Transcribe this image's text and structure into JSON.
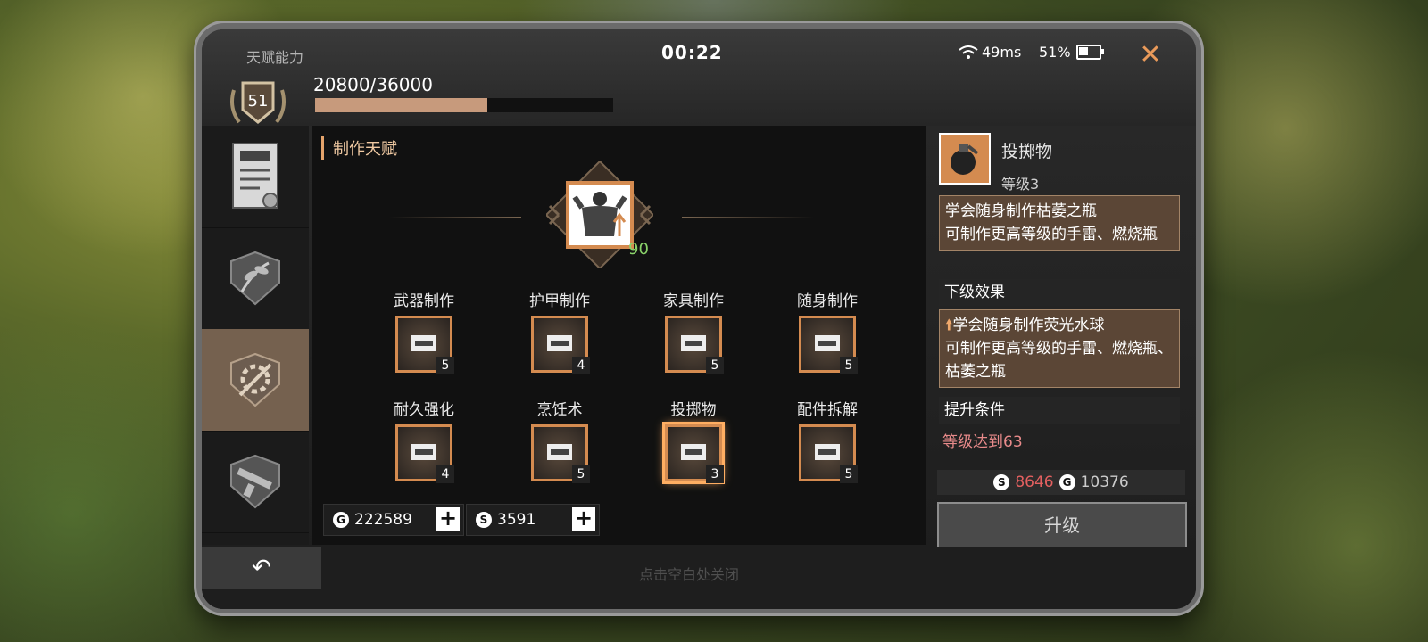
{
  "header": {
    "title": "天赋能力",
    "timer": "00:22",
    "ping": "49ms",
    "battery_percent": "51%",
    "battery_level": 0.51,
    "close_icon": "close-icon"
  },
  "player": {
    "level": "51",
    "xp_text": "20800/36000",
    "xp_fraction": 0.578
  },
  "sidebar": {
    "items": [
      {
        "icon": "trade-scroll-icon"
      },
      {
        "icon": "herb-icon"
      },
      {
        "icon": "crafting-gear-icon"
      },
      {
        "icon": "weapon-icon"
      }
    ],
    "active_index": 2
  },
  "main": {
    "section_title": "制作天赋",
    "center_points": "90",
    "skills": [
      {
        "name": "武器制作",
        "level": "5",
        "icon": "pistol-icon"
      },
      {
        "name": "护甲制作",
        "level": "4",
        "icon": "armor-icon"
      },
      {
        "name": "家具制作",
        "level": "5",
        "icon": "furniture-icon"
      },
      {
        "name": "随身制作",
        "level": "5",
        "icon": "case-icon"
      },
      {
        "name": "耐久强化",
        "level": "4",
        "icon": "calculator-icon"
      },
      {
        "name": "烹饪术",
        "level": "5",
        "icon": "stove-icon"
      },
      {
        "name": "投掷物",
        "level": "3",
        "icon": "grenade-icon"
      },
      {
        "name": "配件拆解",
        "level": "5",
        "icon": "knife-icon"
      }
    ],
    "currency_gold": "222589",
    "currency_silver": "3591"
  },
  "detail": {
    "name": "投掷物",
    "level": "等级3",
    "current_effect": "学会随身制作枯萎之瓶\n可制作更高等级的手雷、燃烧瓶",
    "next_title": "下级效果",
    "next_effect": "学会随身制作荧光水球\n可制作更高等级的手雷、燃烧瓶、枯萎之瓶",
    "cond_title": "提升条件",
    "condition": "等级达到63",
    "cost_silver": "8646",
    "cost_gold": "10376",
    "upgrade_label": "升级"
  },
  "footer": {
    "back_icon": "back-arrow-icon",
    "hint": "点击空白处关闭"
  },
  "colors": {
    "accent": "#d48b50",
    "highlight": "#ffae62",
    "cost_red": "#e46060"
  }
}
